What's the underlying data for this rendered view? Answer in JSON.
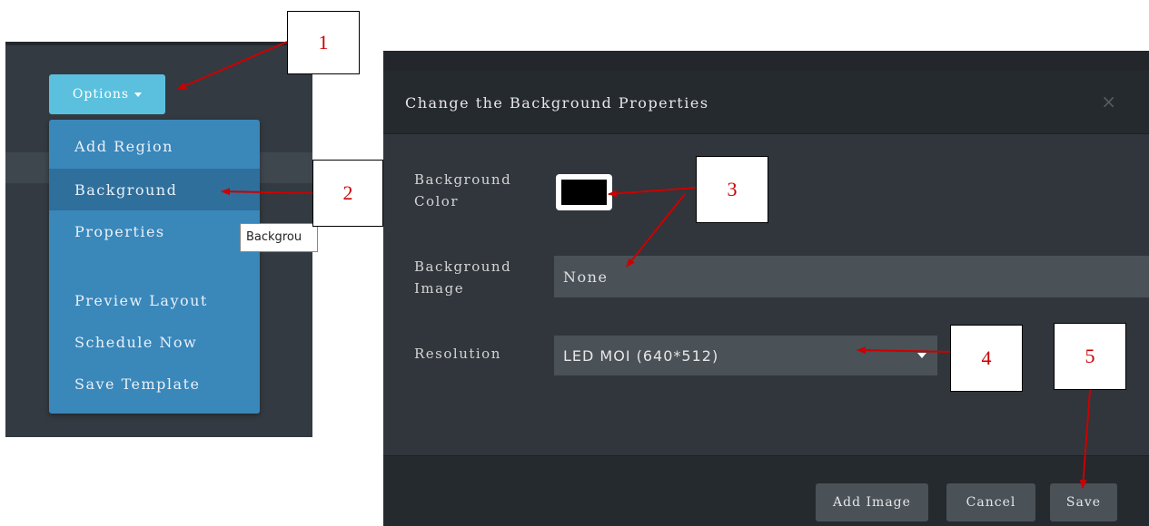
{
  "options_menu": {
    "button_label": "Options",
    "items": [
      {
        "label": "Add Region",
        "active": false
      },
      {
        "label": "Background",
        "active": true
      },
      {
        "label": "Properties",
        "active": false
      },
      {
        "label": "Preview Layout",
        "active": false
      },
      {
        "label": "Schedule Now",
        "active": false
      },
      {
        "label": "Save Template",
        "active": false
      }
    ],
    "tooltip": "Backgrou"
  },
  "modal": {
    "title": "Change the Background Properties",
    "close_icon": "×",
    "fields": {
      "background_color": {
        "label_line1": "Background",
        "label_line2": "Color",
        "value": "#000000"
      },
      "background_image": {
        "label_line1": "Background",
        "label_line2": "Image",
        "value": "None"
      },
      "resolution": {
        "label": "Resolution",
        "value": "LED MOI (640*512)"
      }
    },
    "footer": {
      "add_image": "Add Image",
      "cancel": "Cancel",
      "save": "Save"
    }
  },
  "annotations": [
    "1",
    "2",
    "3",
    "4",
    "5"
  ],
  "colors": {
    "annotation": "#cc0000",
    "menu_bg": "#3a87ba",
    "options_button": "#5bc0de",
    "modal_bg": "#30363c"
  }
}
